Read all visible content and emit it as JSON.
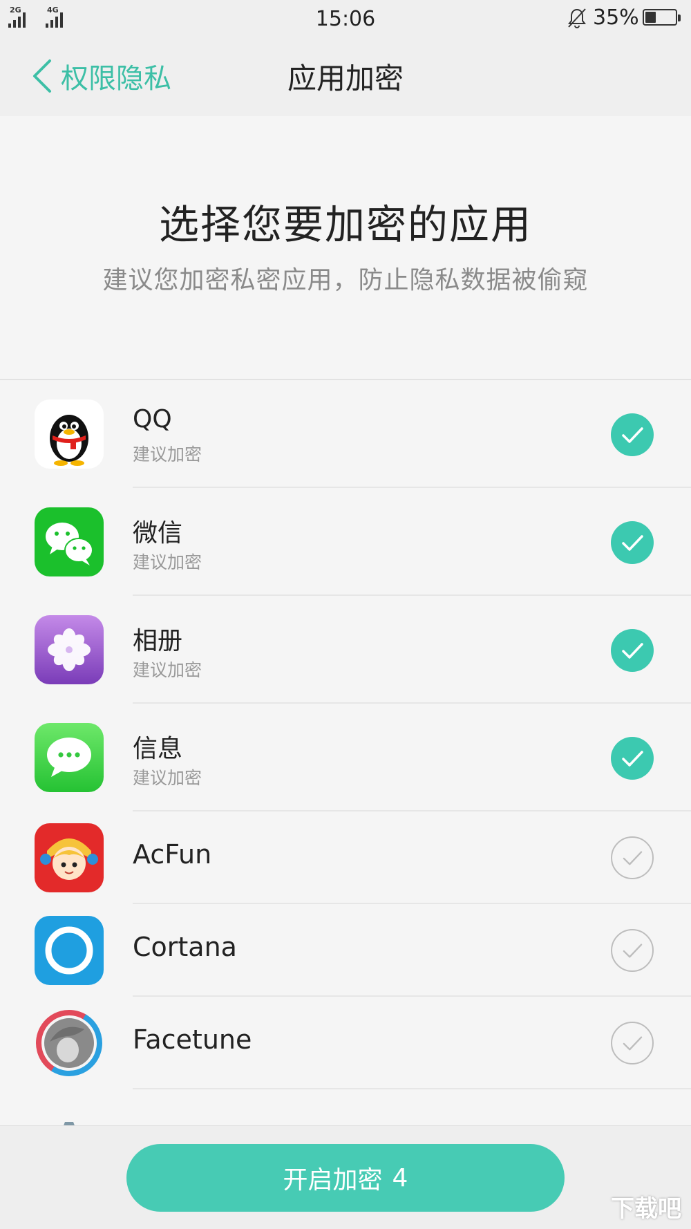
{
  "status_bar": {
    "network1": "2G",
    "network2": "4G",
    "time": "15:06",
    "battery_percent": "35%",
    "battery_level": 0.35,
    "icons": [
      "signal-icon",
      "signal-icon",
      "bell-muted-icon",
      "battery-icon"
    ]
  },
  "navbar": {
    "back_label": "权限隐私",
    "title": "应用加密"
  },
  "hero": {
    "title": "选择您要加密的应用",
    "subtitle": "建议您加密私密应用，防止隐私数据被偷窥"
  },
  "apps": [
    {
      "name": "QQ",
      "hint": "建议加密",
      "checked": true,
      "icon": "qq-icon"
    },
    {
      "name": "微信",
      "hint": "建议加密",
      "checked": true,
      "icon": "wechat-icon"
    },
    {
      "name": "相册",
      "hint": "建议加密",
      "checked": true,
      "icon": "photos-icon"
    },
    {
      "name": "信息",
      "hint": "建议加密",
      "checked": true,
      "icon": "messages-icon"
    },
    {
      "name": "AcFun",
      "hint": "",
      "checked": false,
      "icon": "acfun-icon"
    },
    {
      "name": "Cortana",
      "hint": "",
      "checked": false,
      "icon": "cortana-icon"
    },
    {
      "name": "Facetune",
      "hint": "",
      "checked": false,
      "icon": "facetune-icon"
    }
  ],
  "action": {
    "label": "开启加密",
    "count": "4"
  },
  "watermark": "下载吧",
  "colors": {
    "accent": "#3cc9b0",
    "button": "#47cbb4",
    "background": "#f5f5f5"
  }
}
